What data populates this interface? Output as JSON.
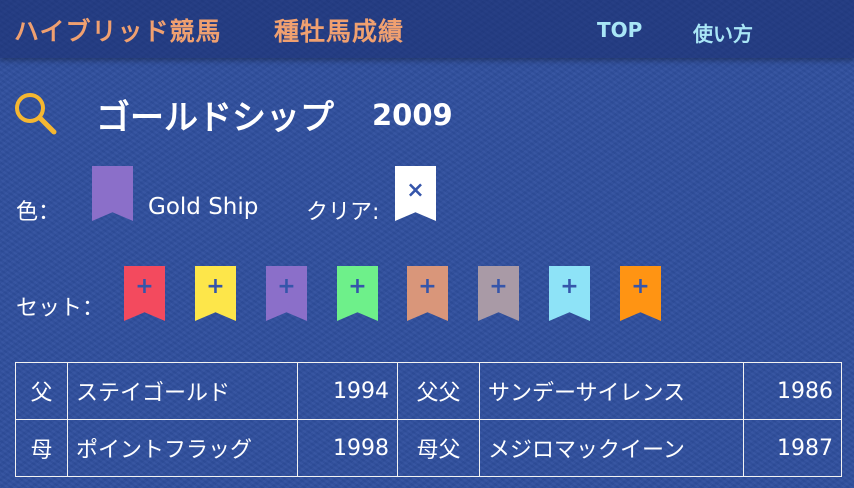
{
  "header": {
    "site_title": "ハイブリッド競馬",
    "page_name": "種牡馬成績",
    "nav": [
      {
        "label": "TOP"
      },
      {
        "label": "使い方"
      }
    ]
  },
  "horse": {
    "name": "ゴールドシップ",
    "year": "2009"
  },
  "color_row": {
    "label": "色：",
    "current_color": "#8b6fc9",
    "color_name": "Gold Ship",
    "clear_label": "クリア:",
    "clear_symbol": "×"
  },
  "set_row": {
    "label": "セット：",
    "symbol": "+",
    "colors": [
      "#f34a5e",
      "#fde64a",
      "#8b6fc9",
      "#6ef08a",
      "#d9967a",
      "#a99aa6",
      "#8ee3f7",
      "#ff9413"
    ]
  },
  "pedigree": {
    "rows": [
      {
        "rel": "父",
        "name": "ステイゴールド",
        "year": "1994",
        "rel2": "父父",
        "name2": "サンデーサイレンス",
        "year2": "1986"
      },
      {
        "rel": "母",
        "name": "ポイントフラッグ",
        "year": "1998",
        "rel2": "母父",
        "name2": "メジロマックイーン",
        "year2": "1987"
      }
    ]
  }
}
